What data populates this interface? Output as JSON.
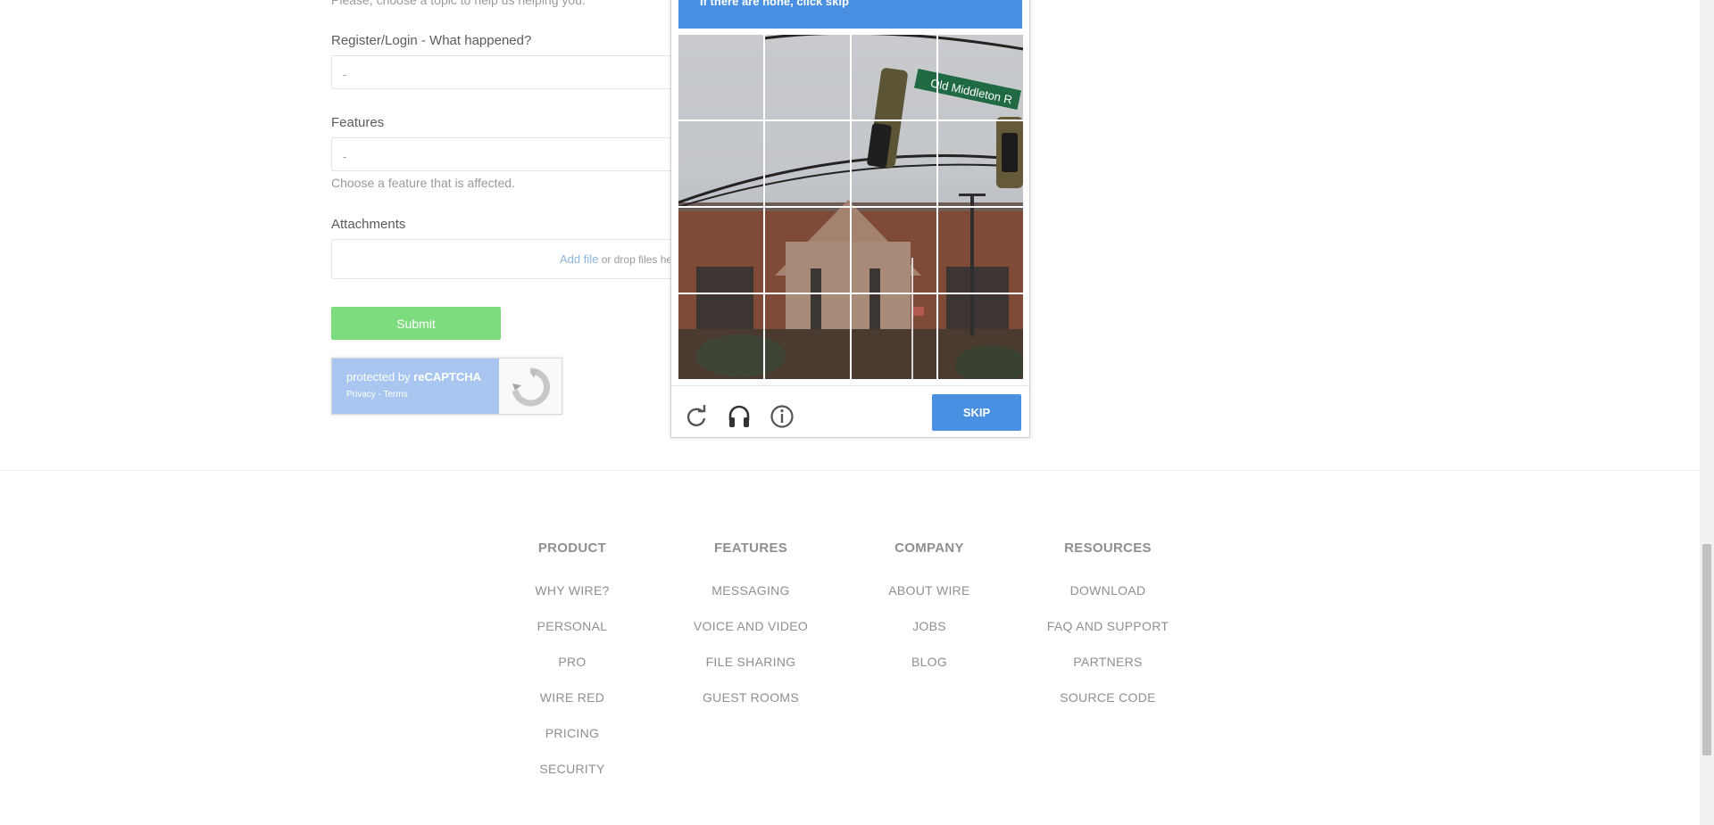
{
  "form": {
    "topic_hint": "Please, choose a topic to help us helping you.",
    "what_happened_label": "Register/Login - What happened?",
    "what_happened_value": "-",
    "features_label": "Features",
    "features_value": "-",
    "features_hint": "Choose a feature that is affected.",
    "attachments_label": "Attachments",
    "add_file": "Add file",
    "drop_text": "or drop files here",
    "submit_label": "Submit"
  },
  "recaptcha_badge": {
    "protected_by": "protected by",
    "brand": "reCAPTCHA",
    "links": "Privacy - Terms"
  },
  "captcha": {
    "instruction": "If there are none, click skip",
    "street_sign": "Old Middleton R",
    "tile_count": 16,
    "skip_label": "SKIP",
    "icons": [
      "reload-icon",
      "headphones-icon",
      "info-icon"
    ]
  },
  "footer": {
    "columns": [
      {
        "heading": "PRODUCT",
        "links": [
          "WHY WIRE?",
          "PERSONAL",
          "PRO",
          "WIRE RED",
          "PRICING",
          "SECURITY"
        ]
      },
      {
        "heading": "FEATURES",
        "links": [
          "MESSAGING",
          "VOICE AND VIDEO",
          "FILE SHARING",
          "GUEST ROOMS"
        ]
      },
      {
        "heading": "COMPANY",
        "links": [
          "ABOUT WIRE",
          "JOBS",
          "BLOG"
        ]
      },
      {
        "heading": "RESOURCES",
        "links": [
          "DOWNLOAD",
          "FAQ AND SUPPORT",
          "PARTNERS",
          "SOURCE CODE"
        ]
      }
    ]
  },
  "colors": {
    "submit": "#7ddc7e",
    "captcha_blue": "#4a90e2",
    "badge_blue": "#a8c6f0",
    "footer_text": "#8f8f8f"
  }
}
